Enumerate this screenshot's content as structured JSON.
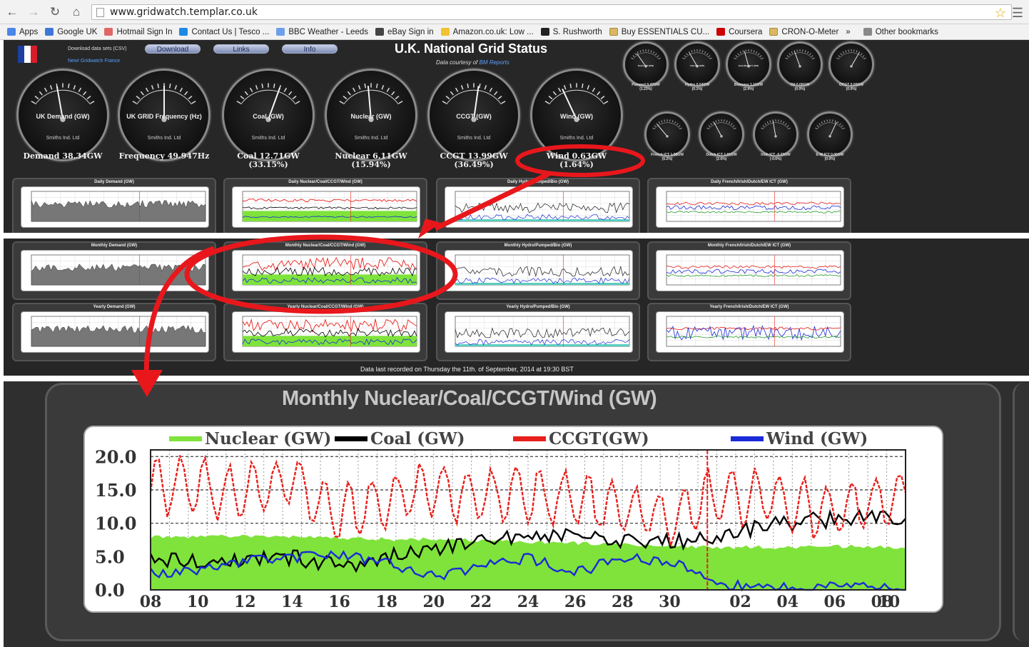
{
  "browser": {
    "url": "www.gridwatch.templar.co.uk",
    "bookmarks": [
      "Apps",
      "Google UK",
      "Hotmail Sign In",
      "Contact Us | Tesco ...",
      "BBC Weather - Leeds",
      "eBay Sign in",
      "Amazon.co.uk: Low ...",
      "S. Rushworth",
      "Buy ESSENTIALS CU...",
      "Coursera",
      "CRON-O-Meter",
      "»",
      "Other bookmarks"
    ]
  },
  "header": {
    "download_data": "Download data sets (CSV)",
    "new_gridwatch": "New! Gridwatch France",
    "buttons": [
      "Download",
      "Links",
      "Info"
    ],
    "title": "U.K. National Grid Status",
    "courtesy": "Data courtesy of",
    "courtesy_link": "BM Reports"
  },
  "gauges": [
    {
      "name": "UK Demand (GW)",
      "maker": "Smiths Ind. Ltd",
      "readout": "Demand 38.34GW",
      "sub": ""
    },
    {
      "name": "UK GRID Frequency (Hz)",
      "maker": "Smiths Ind. Ltd",
      "readout": "Frequency 49.947Hz",
      "sub": ""
    },
    {
      "name": "Coal (GW)",
      "maker": "Smiths Ind. Ltd",
      "readout": "Coal 12.71GW",
      "sub": "(33.15%)"
    },
    {
      "name": "Nuclear (GW)",
      "maker": "Smiths Ind. Ltd",
      "readout": "Nuclear 6.11GW",
      "sub": "(15.94%)"
    },
    {
      "name": "CCGT (GW)",
      "maker": "Smiths Ind. Ltd",
      "readout": "CCGT 13.99GW",
      "sub": "(36.49%)"
    },
    {
      "name": "Wind (GW)",
      "maker": "Smiths Ind. Ltd",
      "readout": "Wind 0.63GW",
      "sub": "(1.64%)"
    }
  ],
  "mini_gauges": [
    {
      "name": "Pumped Storage (GW)",
      "readout": "Pumped 0.47GW",
      "sub": "(1.23%)"
    },
    {
      "name": "Hydro (GW)",
      "readout": "Hydro 0.04GW",
      "sub": "(0.1%)"
    },
    {
      "name": "Biomass (GW)",
      "readout": "Biomass 1.11GW",
      "sub": "(2.9%)"
    },
    {
      "name": "Oil (GW)",
      "readout": "Oil 0.00GW",
      "sub": "(0.0%)"
    },
    {
      "name": "OCGT (GW)",
      "readout": "OCGT 0.00GW",
      "sub": "(0.0%)"
    },
    {
      "name": "French ICT (GW)",
      "readout": "French ICT 1.98GW",
      "sub": "(5.2%)"
    },
    {
      "name": "Dutch ICT (GW)",
      "readout": "Dutch ICT 1.01GW",
      "sub": "(2.6%)"
    },
    {
      "name": "Irish ICT (GW)",
      "readout": "Irish ICT -0.23GW",
      "sub": "(-0.6%)"
    },
    {
      "name": "East-West ICT (GW)",
      "readout": "E-W ICT 0.00GW",
      "sub": "(0.0%)"
    }
  ],
  "panels": [
    {
      "title": "Daily Demand (GW)"
    },
    {
      "title": "Daily Nuclear/Coal/CCGT/Wind (GW)"
    },
    {
      "title": "Daily Hydro/Pumped/Bio (GW)"
    },
    {
      "title": "Daily French/Irish/Dutch/EW ICT (GW)"
    },
    {
      "title": "Monthly Demand (GW)"
    },
    {
      "title": "Monthly Nuclear/Coal/CCGT/Wind (GW)"
    },
    {
      "title": "Monthly Hydro/Pumped/Bio (GW)"
    },
    {
      "title": "Monthly French/Irish/Dutch/EW ICT (GW)"
    },
    {
      "title": "Yearly Demand (GW)"
    },
    {
      "title": "Yearly Nuclear/Coal/CCGT/Wind (GW)"
    },
    {
      "title": "Yearly Hydro/Pumped/Bio (GW)"
    },
    {
      "title": "Yearly French/Irish/Dutch/EW ICT (GW)"
    }
  ],
  "recorded": "Data last recorded on Thursday the 11th. of September, 2014 at 19:30 BST",
  "zoom": {
    "title": "Monthly Nuclear/Coal/CCGT/Wind (GW)"
  },
  "chart_data": {
    "type": "line",
    "title": "Monthly Nuclear/Coal/CCGT/Wind (GW)",
    "xlabel": "",
    "ylabel": "",
    "ylim": [
      0,
      21
    ],
    "yticks": [
      "0.0",
      "5.0",
      "10.0",
      "15.0",
      "20.0"
    ],
    "xticks": [
      "08",
      "10",
      "12",
      "14",
      "16",
      "18",
      "20",
      "22",
      "24",
      "26",
      "28",
      "30",
      "02",
      "04",
      "06",
      "08",
      "10"
    ],
    "legend": [
      "Nuclear (GW)",
      "Coal (GW)",
      "CCGT(GW)",
      "Wind (GW)"
    ],
    "legend_position": "top",
    "grid": true,
    "x": [
      0,
      2,
      4,
      6,
      8,
      10,
      12,
      14,
      16,
      18,
      20,
      22,
      24,
      26,
      28,
      30,
      32
    ],
    "series": [
      {
        "name": "Nuclear (GW)",
        "color": "#7fe33b",
        "type": "area",
        "values": [
          8.0,
          8.0,
          8.0,
          8.0,
          7.8,
          7.6,
          7.6,
          7.4,
          7.2,
          7.0,
          6.8,
          6.6,
          6.4,
          6.4,
          6.4,
          6.6,
          6.4
        ]
      },
      {
        "name": "Coal (GW)",
        "color": "#000000",
        "values": [
          5.0,
          4.2,
          4.6,
          4.8,
          3.5,
          5.0,
          6.2,
          7.6,
          7.8,
          8.0,
          7.6,
          7.2,
          8.0,
          9.6,
          10.4,
          10.8,
          11.0
        ]
      },
      {
        "name": "CCGT(GW)",
        "color": "#e8201c",
        "values": [
          15.5,
          15.2,
          14.2,
          16.5,
          11.5,
          13.0,
          15.5,
          14.0,
          14.2,
          13.6,
          12.4,
          11.0,
          14.2,
          13.8,
          12.0,
          12.4,
          14.0
        ]
      },
      {
        "name": "Wind (GW)",
        "color": "#1a2ad8",
        "values": [
          2.5,
          3.0,
          4.5,
          4.8,
          5.2,
          4.0,
          2.0,
          3.5,
          4.8,
          2.5,
          5.0,
          4.2,
          1.0,
          0.4,
          0.6,
          0.3,
          0.6
        ]
      }
    ]
  },
  "colors": {
    "accent_red": "#e8201c",
    "nuclear": "#7fe33b",
    "coal": "#000000",
    "ccgt": "#e8201c",
    "wind": "#1a2ad8"
  }
}
